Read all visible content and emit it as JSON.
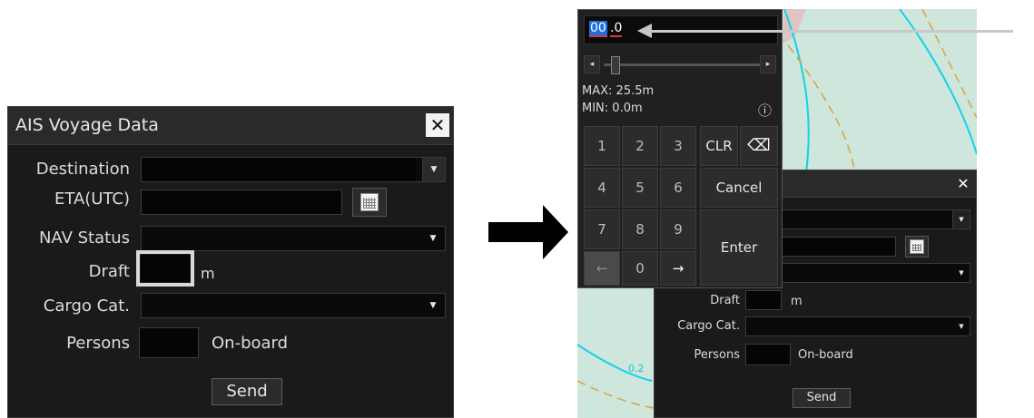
{
  "left_dialog": {
    "title": "AIS Voyage Data",
    "close_symbol": "✕",
    "labels": {
      "destination": "Destination",
      "eta": "ETA(UTC)",
      "nav_status": "NAV Status",
      "draft": "Draft",
      "cargo": "Cargo Cat.",
      "persons": "Persons"
    },
    "draft_unit": "m",
    "persons_unit": "On-board",
    "send": "Send",
    "dropdown_icon": "triangle-down-icon",
    "calendar_icon": "calendar-icon"
  },
  "keypad": {
    "value_selected": "00",
    "value_rest": ".0",
    "max_label": "MAX:",
    "max_value": "25.5m",
    "min_label": "MIN:",
    "min_value": "0.0m",
    "slider_left": "◂",
    "slider_right": "▸",
    "info_symbol": "ⓘ",
    "keys": {
      "k1": "1",
      "k2": "2",
      "k3": "3",
      "k4": "4",
      "k5": "5",
      "k6": "6",
      "k7": "7",
      "k8": "8",
      "k9": "9",
      "left": "←",
      "k0": "0",
      "right": "→",
      "clr": "CLR",
      "backspace": "⌫",
      "cancel": "Cancel",
      "enter": "Enter"
    }
  },
  "right_dialog": {
    "close_symbol": "✕",
    "draft_label": "Draft",
    "draft_unit": "m",
    "cargo_label": "Cargo Cat.",
    "persons_label": "Persons",
    "persons_unit": "On-board",
    "send": "Send"
  },
  "map": {
    "depth_label": "0.2",
    "water_color": "#cfe6dc",
    "contour_cyan": "#12d3e8",
    "contour_orange": "#d9a441"
  },
  "colors": {
    "dialog_bg": "#1a1a1a",
    "title_bg": "#2a2a2a",
    "selection_blue": "#1e6fe0",
    "highlight_box": "#d9d9d9"
  }
}
